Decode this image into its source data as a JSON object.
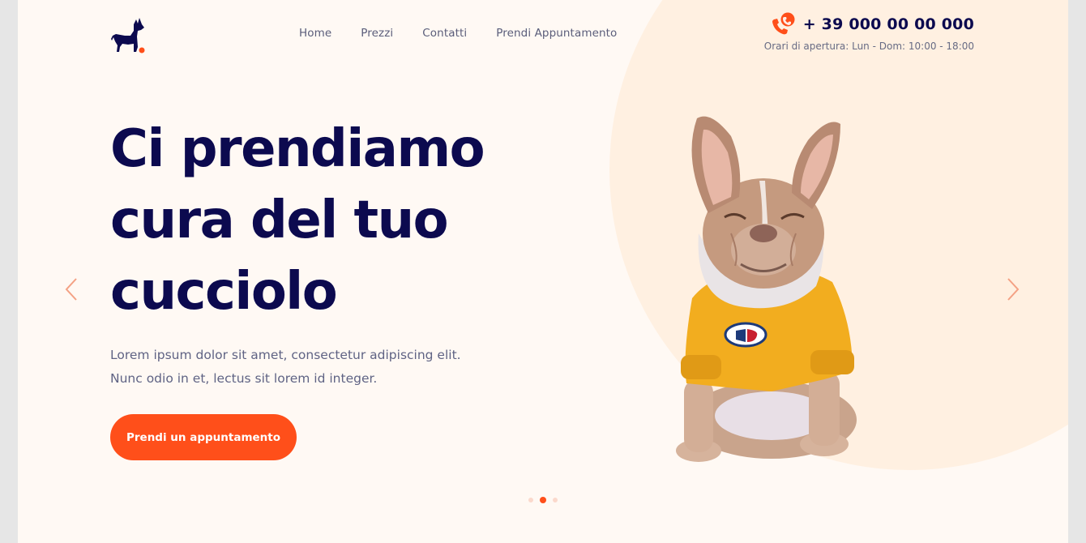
{
  "nav": {
    "items": [
      {
        "label": "Home"
      },
      {
        "label": "Prezzi"
      },
      {
        "label": "Contatti"
      },
      {
        "label": "Prendi Appuntamento"
      }
    ]
  },
  "contact": {
    "phone": "+ 39 000 00 00 000",
    "hours": "Orari di apertura: Lun - Dom: 10:00 - 18:00"
  },
  "hero": {
    "title_line_1": "Ci prendiamo",
    "title_line_2": "cura del tuo",
    "title_line_3": "cucciolo",
    "text_line_1": "Lorem ipsum dolor sit amet, consectetur adipiscing elit.",
    "text_line_2": "Nunc odio in et, lectus sit lorem id integer.",
    "cta_label": "Prendi un appuntamento"
  },
  "slider": {
    "slide_count": 3,
    "active_slide": 2
  },
  "icons": {
    "logo": "dog-logo-icon",
    "phone": "phone-icon",
    "prev": "chevron-left-icon",
    "next": "chevron-right-icon"
  },
  "colors": {
    "navy": "#0c0a4f",
    "accent": "#ff4f1a",
    "background": "#fff9f4",
    "blob": "#fff0e1"
  }
}
